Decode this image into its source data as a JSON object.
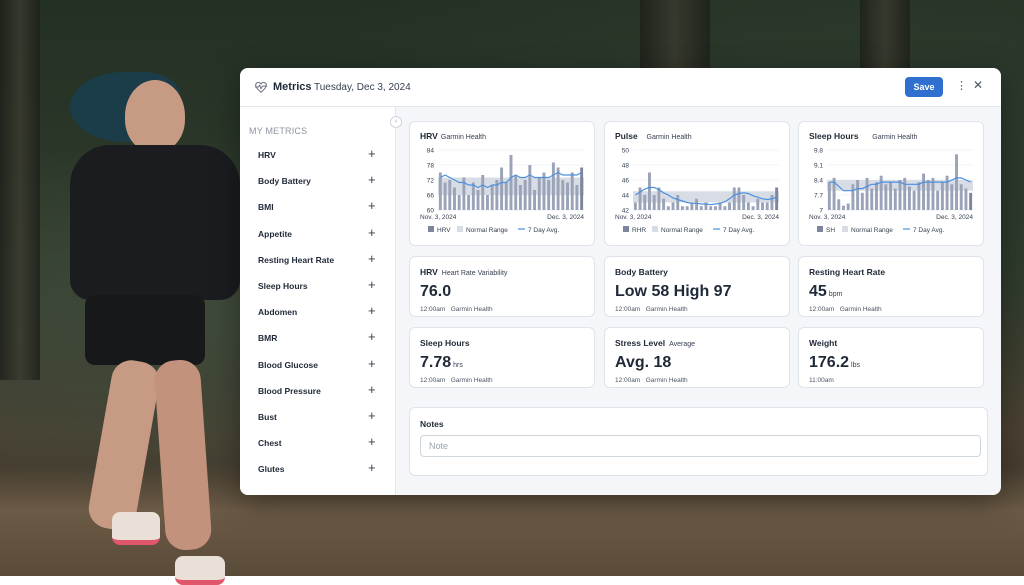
{
  "header": {
    "title": "Metrics",
    "date": "Tuesday, Dec 3, 2024",
    "save_label": "Save",
    "more_glyph": "⋮",
    "close_glyph": "✕"
  },
  "sidebar": {
    "heading": "MY METRICS",
    "items": [
      {
        "label": "HRV"
      },
      {
        "label": "Body Battery"
      },
      {
        "label": "BMI"
      },
      {
        "label": "Appetite"
      },
      {
        "label": "Resting Heart Rate"
      },
      {
        "label": "Sleep Hours"
      },
      {
        "label": "Abdomen"
      },
      {
        "label": "BMR"
      },
      {
        "label": "Blood Glucose"
      },
      {
        "label": "Blood Pressure"
      },
      {
        "label": "Bust"
      },
      {
        "label": "Chest"
      },
      {
        "label": "Glutes"
      }
    ],
    "plus_glyph": "+",
    "collapse_glyph": "‹"
  },
  "chart_data": [
    {
      "type": "bar",
      "title": "HRV",
      "subtitle": "Garmin Health",
      "yticks": [
        60,
        66,
        72,
        78,
        84
      ],
      "ylim": [
        60,
        84
      ],
      "x_start": "Nov. 3, 2024",
      "x_end": "Dec. 3, 2024",
      "normal_range": [
        66,
        73
      ],
      "series": [
        {
          "name": "HRV",
          "values": [
            75,
            71,
            72,
            69,
            66,
            73,
            66,
            71,
            68,
            74,
            66,
            70,
            72,
            77,
            71,
            82,
            74,
            70,
            72,
            78,
            68,
            73,
            75,
            72,
            79,
            77,
            72,
            71,
            75,
            70,
            77
          ]
        },
        {
          "name": "7 Day Avg.",
          "values": [
            73,
            74,
            73,
            72,
            71,
            71,
            70,
            70,
            69,
            70,
            69,
            70,
            70,
            71,
            71,
            73,
            74,
            73,
            73,
            74,
            73,
            73,
            73,
            73,
            74,
            75,
            74,
            74,
            74,
            74,
            75
          ]
        }
      ],
      "legend": [
        "HRV",
        "Normal Range",
        "7 Day Avg."
      ]
    },
    {
      "type": "bar",
      "title": "Pulse",
      "subtitle": "Garmin Health",
      "yticks": [
        42,
        44,
        46,
        48,
        50
      ],
      "ylim": [
        42,
        50
      ],
      "x_start": "Nov. 3, 2024",
      "x_end": "Dec. 3, 2024",
      "normal_range": [
        43,
        44.5
      ],
      "series": [
        {
          "name": "RHR",
          "values": [
            43,
            45,
            44,
            47,
            44,
            45,
            43.5,
            42.5,
            43,
            44,
            42.5,
            42.5,
            43,
            43.5,
            42.5,
            43,
            42.5,
            42.5,
            43,
            42.5,
            43,
            45,
            45,
            44,
            43,
            42.5,
            43.5,
            43,
            43,
            44,
            45
          ]
        },
        {
          "name": "7 Day Avg.",
          "values": [
            44,
            44.4,
            44.8,
            45,
            45,
            44.7,
            44.3,
            44,
            43.6,
            43.4,
            43.2,
            43,
            42.9,
            42.9,
            42.8,
            42.8,
            42.7,
            42.8,
            42.9,
            43.1,
            43.5,
            44,
            44.2,
            44.3,
            44.2,
            43.9,
            43.7,
            43.5,
            43.4,
            43.5,
            43.7
          ]
        }
      ],
      "legend": [
        "RHR",
        "Normal Range",
        "7 Day Avg."
      ]
    },
    {
      "type": "bar",
      "title": "Sleep Hours",
      "subtitle": "Garmin Health",
      "yticks": [
        7,
        7.7,
        8.4,
        9.1,
        9.8
      ],
      "ylim": [
        7,
        9.8
      ],
      "x_start": "Nov. 3, 2024",
      "x_end": "Dec. 3, 2024",
      "normal_range": [
        7.9,
        8.4
      ],
      "series": [
        {
          "name": "SH",
          "values": [
            8.3,
            8.5,
            7.5,
            7.2,
            7.3,
            8.2,
            8.4,
            7.8,
            8.5,
            8.0,
            8.3,
            8.6,
            8.2,
            8.3,
            8.0,
            8.4,
            8.5,
            8.1,
            7.9,
            8.3,
            8.7,
            8.4,
            8.5,
            7.9,
            8.3,
            8.6,
            8.2,
            9.6,
            8.2,
            8.0,
            7.8
          ]
        },
        {
          "name": "7 Day Avg.",
          "values": [
            8.3,
            8.3,
            8.1,
            7.9,
            7.9,
            7.9,
            8.0,
            8.0,
            8.1,
            8.2,
            8.2,
            8.3,
            8.3,
            8.3,
            8.3,
            8.3,
            8.2,
            8.2,
            8.2,
            8.2,
            8.3,
            8.3,
            8.3,
            8.3,
            8.3,
            8.3,
            8.4,
            8.5,
            8.5,
            8.4,
            8.3
          ]
        }
      ],
      "legend": [
        "SH",
        "Normal Range",
        "7 Day Avg."
      ]
    }
  ],
  "stats": [
    {
      "title": "HRV",
      "subtitle": "Heart Rate Variability",
      "value": "76.0",
      "unit": "",
      "time": "12:00am",
      "source": "Garmin Health"
    },
    {
      "title": "Body Battery",
      "subtitle": "",
      "value": "Low 58 High 97",
      "unit": "",
      "time": "12:00am",
      "source": "Garmin Health"
    },
    {
      "title": "Resting Heart Rate",
      "subtitle": "",
      "value": "45",
      "unit": "bpm",
      "time": "12:00am",
      "source": "Garmin Health"
    },
    {
      "title": "Sleep Hours",
      "subtitle": "",
      "value": "7.78",
      "unit": "hrs",
      "time": "12:00am",
      "source": "Garmin Health"
    },
    {
      "title": "Stress Level",
      "subtitle": "Average",
      "value": "Avg. 18",
      "unit": "",
      "time": "12:00am",
      "source": "Garmin Health"
    },
    {
      "title": "Weight",
      "subtitle": "",
      "value": "176.2",
      "unit": "lbs",
      "time": "11:00am",
      "source": ""
    }
  ],
  "notes": {
    "title": "Notes",
    "placeholder": "Note",
    "value": ""
  },
  "colors": {
    "bar": "#9aa3b8",
    "bar_dark": "#7d869d",
    "range": "#d8dde5",
    "avg": "#4a8fe0",
    "accent": "#2f6fd0"
  }
}
